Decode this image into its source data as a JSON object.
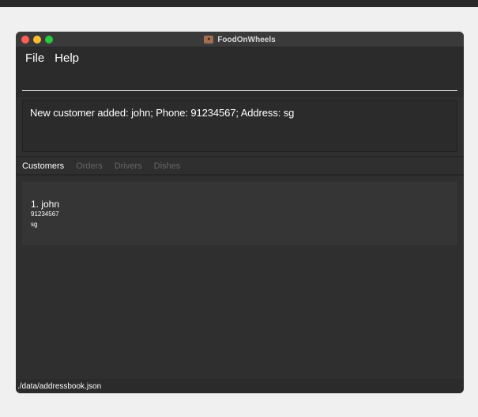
{
  "window": {
    "title": "FoodOnWheels"
  },
  "menu": {
    "items": [
      {
        "label": "File"
      },
      {
        "label": "Help"
      }
    ]
  },
  "command": {
    "value": "",
    "placeholder": ""
  },
  "result": {
    "message": "New customer added: john; Phone: 91234567; Address: sg"
  },
  "tabs": [
    {
      "label": "Customers",
      "active": true
    },
    {
      "label": "Orders",
      "active": false
    },
    {
      "label": "Drivers",
      "active": false
    },
    {
      "label": "Dishes",
      "active": false
    }
  ],
  "customers": [
    {
      "index_name": "1.  john",
      "phone": "91234567",
      "address": "sg"
    }
  ],
  "status": {
    "file_path": "./data/addressbook.json"
  },
  "colors": {
    "window_bg": "#2f2f2f",
    "text": "#ffffff",
    "inactive_tab": "#666666"
  }
}
